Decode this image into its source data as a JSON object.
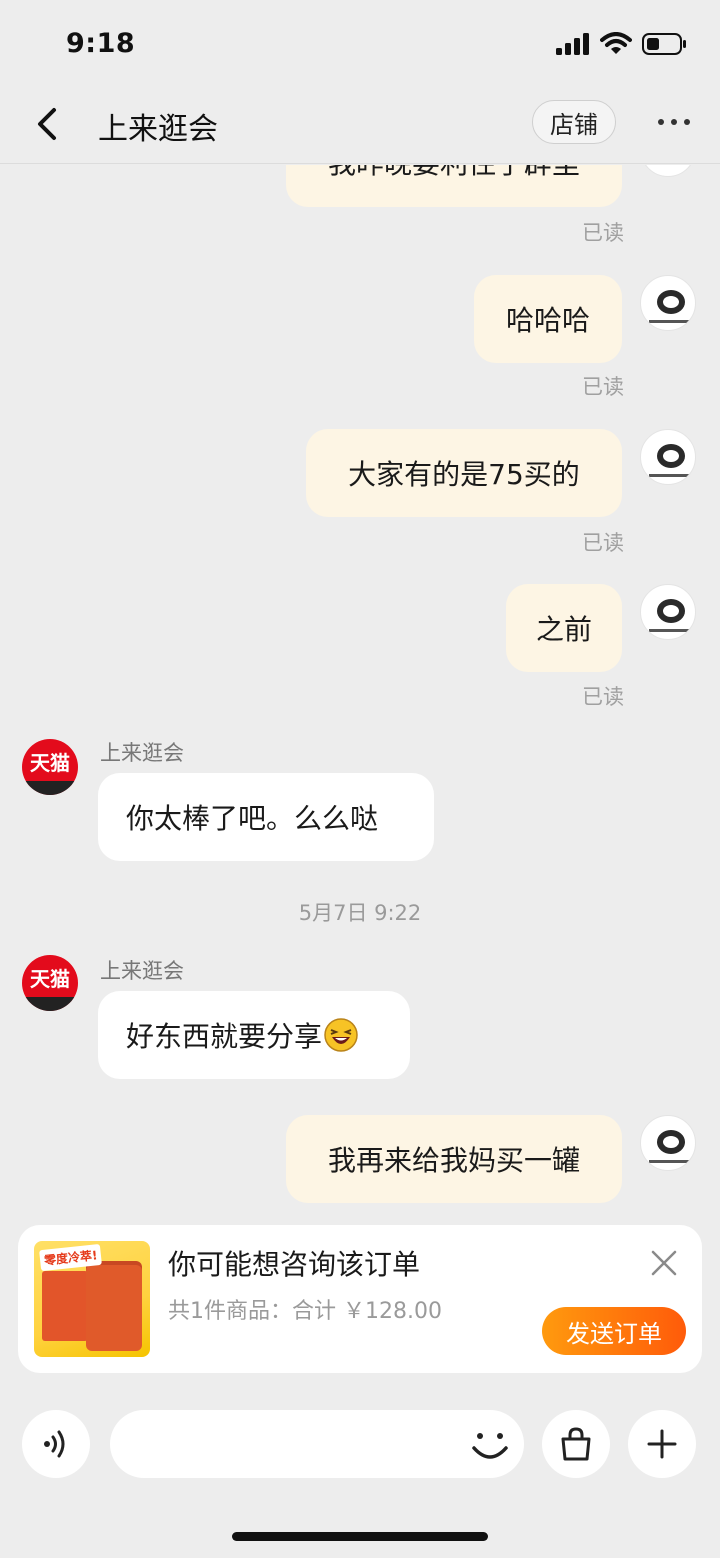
{
  "status_bar": {
    "time": "9:18"
  },
  "nav": {
    "title": "上来逛会",
    "shop_button": "店铺"
  },
  "messages": {
    "m0": {
      "text": "我昨晚要利住了辟里",
      "read": "已读"
    },
    "m1": {
      "text": "哈哈哈",
      "read": "已读"
    },
    "m2": {
      "text": "大家有的是75买的",
      "read": "已读"
    },
    "m3": {
      "text": "之前",
      "read": "已读"
    },
    "m4": {
      "sender": "上来逛会",
      "avatar_text": "天猫",
      "text": "你太棒了吧。么么哒"
    },
    "ts": "5月7日 9:22",
    "m5": {
      "sender": "上来逛会",
      "avatar_text": "天猫",
      "text": "好东西就要分享"
    },
    "m6": {
      "text": "我再来给我妈买一罐"
    }
  },
  "order_card": {
    "title": "你可能想咨询该订单",
    "summary": "共1件商品：合计 ￥128.00",
    "thumb_badge": "零度冷萃!",
    "send_button": "发送订单"
  },
  "icons": {
    "back": "chevron-left-icon",
    "more": "more-dots-icon",
    "close": "close-icon",
    "voice": "voice-icon",
    "emoji": "smile-icon",
    "bag": "shopping-bag-icon",
    "plus": "plus-icon"
  },
  "colors": {
    "background": "#ededed",
    "outgoing_bubble": "#fdf5e4",
    "incoming_bubble": "#ffffff",
    "tmall_red": "#e30b1c",
    "send_order_start": "#ff9a0e",
    "send_order_end": "#ff5b0a"
  }
}
